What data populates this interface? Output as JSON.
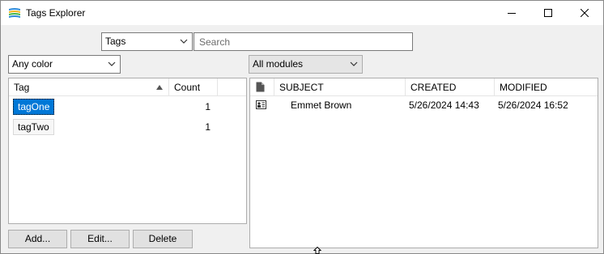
{
  "window": {
    "title": "Tags Explorer",
    "minimize_glyph": "minimize",
    "maximize_glyph": "maximize",
    "close_glyph": "close"
  },
  "toolbar": {
    "scope_select": "Tags",
    "search_placeholder": "Search"
  },
  "filters": {
    "color_select": "Any color",
    "module_select": "All modules"
  },
  "tags_table": {
    "headers": {
      "tag": "Tag",
      "count": "Count"
    },
    "rows": [
      {
        "tag": "tagOne",
        "count": "1",
        "selected": true
      },
      {
        "tag": "tagTwo",
        "count": "1",
        "selected": false
      }
    ]
  },
  "items_table": {
    "headers": {
      "subject": "SUBJECT",
      "created": "CREATED",
      "modified": "MODIFIED"
    },
    "rows": [
      {
        "icon": "contact-card-icon",
        "subject": "Emmet Brown",
        "created": "5/26/2024 14:43",
        "modified": "5/26/2024 16:52"
      }
    ]
  },
  "buttons": {
    "add": "Add...",
    "edit": "Edit...",
    "delete": "Delete"
  },
  "colors": {
    "selection": "#0078d7",
    "title_bar": "#ffffff",
    "window_bg": "#f0f0f0"
  }
}
